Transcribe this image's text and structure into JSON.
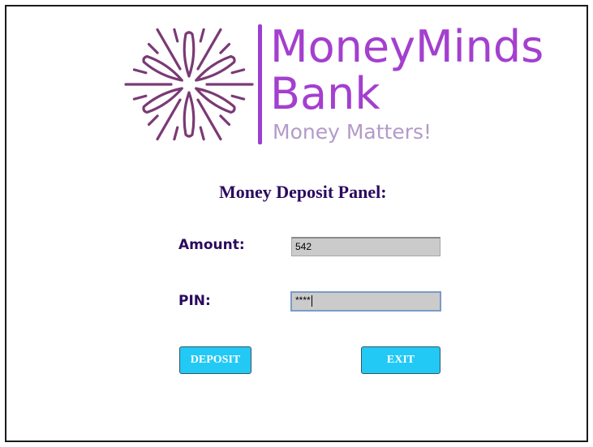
{
  "brand": {
    "name_line1": "MoneyMinds",
    "name_line2": "Bank",
    "tagline": "Money Matters!",
    "logo_icon": "flower-burst-icon",
    "primary_color": "#a43fcf",
    "logo_color": "#7a3a74"
  },
  "panel": {
    "title": "Money Deposit Panel:"
  },
  "form": {
    "amount_label": "Amount:",
    "amount_value": "542",
    "pin_label": "PIN:",
    "pin_value": "****"
  },
  "buttons": {
    "deposit": "DEPOSIT",
    "exit": "EXIT",
    "color": "#22c9f5"
  }
}
